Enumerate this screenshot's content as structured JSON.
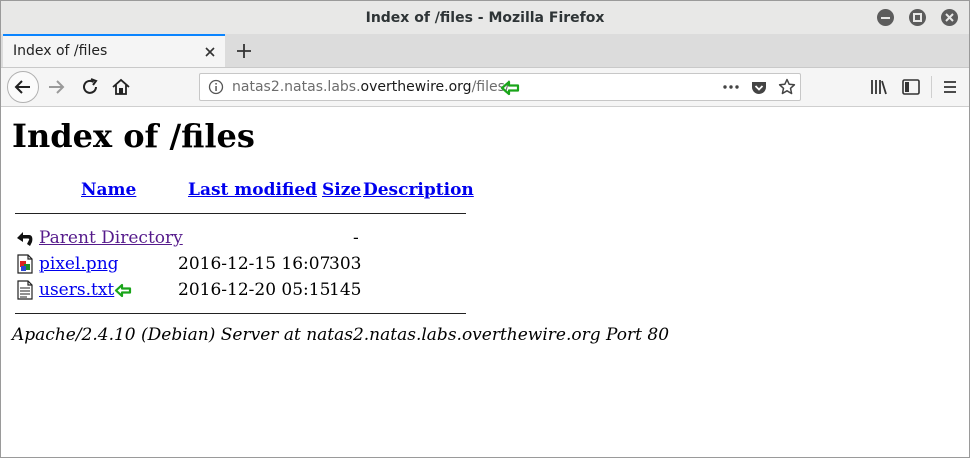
{
  "window": {
    "title": "Index of /files - Mozilla Firefox"
  },
  "tab": {
    "label": "Index of /files"
  },
  "url": {
    "prefix": "natas2.natas.labs.",
    "domain": "overthewire.org",
    "path": "/files/"
  },
  "page": {
    "heading": "Index of /files",
    "columns": {
      "name": "Name",
      "modified": "Last modified",
      "size": "Size",
      "description": "Description"
    },
    "rows": [
      {
        "name": "Parent Directory",
        "modified": "",
        "size": "-",
        "icon": "back-folder-icon"
      },
      {
        "name": "pixel.png",
        "modified": "2016-12-15 16:07",
        "size": "303",
        "icon": "image-file-icon"
      },
      {
        "name": "users.txt",
        "modified": "2016-12-20 05:15",
        "size": "145",
        "icon": "text-file-icon"
      }
    ],
    "address": "Apache/2.4.10 (Debian) Server at natas2.natas.labs.overthewire.org Port 80"
  },
  "colors": {
    "link": "#0000ee",
    "visited": "#551a8b",
    "accent": "#0a84ff",
    "annotation": "#1aa51a"
  }
}
